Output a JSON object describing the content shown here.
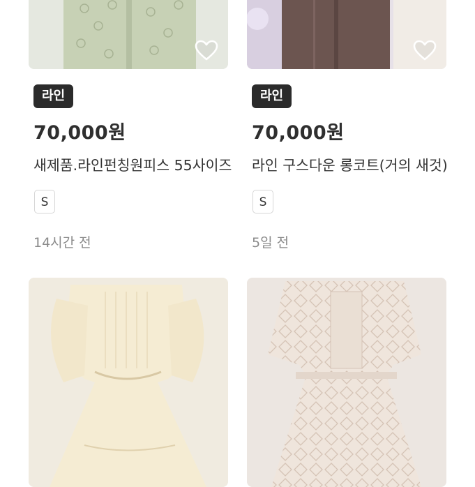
{
  "colors": {
    "badge_bg": "#2b2b2b",
    "price_text": "#2f2f2f",
    "muted_text": "#8a8a8a",
    "heart_outline": "#ffffff"
  },
  "icons": {
    "favorite": "heart-outline-icon"
  },
  "listings": [
    {
      "brand": "라인",
      "price": "70,000원",
      "title": "새제품.라인펀칭원피스 55사이즈",
      "size": "S",
      "posted": "14시간 전",
      "photo_colors": [
        "#c9d3b8",
        "#b3bf9f"
      ]
    },
    {
      "brand": "라인",
      "price": "70,000원",
      "title": "라인 구스다운 롱코트(거의 새것)",
      "size": "S",
      "posted": "5일 전",
      "photo_colors": [
        "#6e5651",
        "#d9d2dc"
      ]
    },
    {
      "photo_colors": [
        "#f4ecd6",
        "#e6d7b4"
      ]
    },
    {
      "photo_colors": [
        "#efe6df",
        "#dbc9bf"
      ]
    }
  ]
}
